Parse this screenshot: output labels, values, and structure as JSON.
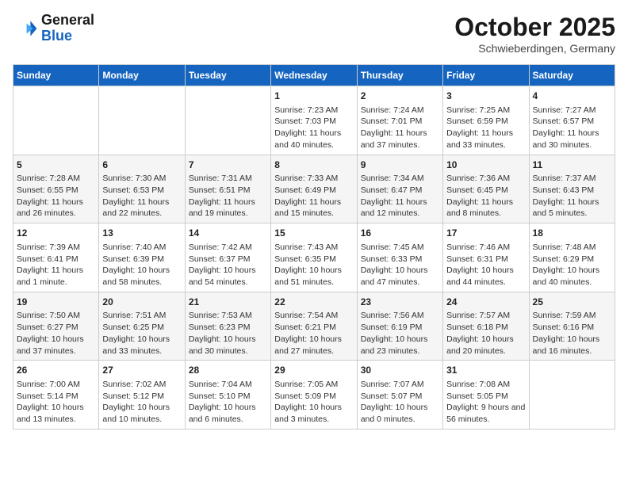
{
  "header": {
    "logo_line1": "General",
    "logo_line2": "Blue",
    "month": "October 2025",
    "location": "Schwieberdingen, Germany"
  },
  "weekdays": [
    "Sunday",
    "Monday",
    "Tuesday",
    "Wednesday",
    "Thursday",
    "Friday",
    "Saturday"
  ],
  "weeks": [
    [
      {
        "day": "",
        "info": ""
      },
      {
        "day": "",
        "info": ""
      },
      {
        "day": "",
        "info": ""
      },
      {
        "day": "1",
        "info": "Sunrise: 7:23 AM\nSunset: 7:03 PM\nDaylight: 11 hours and 40 minutes."
      },
      {
        "day": "2",
        "info": "Sunrise: 7:24 AM\nSunset: 7:01 PM\nDaylight: 11 hours and 37 minutes."
      },
      {
        "day": "3",
        "info": "Sunrise: 7:25 AM\nSunset: 6:59 PM\nDaylight: 11 hours and 33 minutes."
      },
      {
        "day": "4",
        "info": "Sunrise: 7:27 AM\nSunset: 6:57 PM\nDaylight: 11 hours and 30 minutes."
      }
    ],
    [
      {
        "day": "5",
        "info": "Sunrise: 7:28 AM\nSunset: 6:55 PM\nDaylight: 11 hours and 26 minutes."
      },
      {
        "day": "6",
        "info": "Sunrise: 7:30 AM\nSunset: 6:53 PM\nDaylight: 11 hours and 22 minutes."
      },
      {
        "day": "7",
        "info": "Sunrise: 7:31 AM\nSunset: 6:51 PM\nDaylight: 11 hours and 19 minutes."
      },
      {
        "day": "8",
        "info": "Sunrise: 7:33 AM\nSunset: 6:49 PM\nDaylight: 11 hours and 15 minutes."
      },
      {
        "day": "9",
        "info": "Sunrise: 7:34 AM\nSunset: 6:47 PM\nDaylight: 11 hours and 12 minutes."
      },
      {
        "day": "10",
        "info": "Sunrise: 7:36 AM\nSunset: 6:45 PM\nDaylight: 11 hours and 8 minutes."
      },
      {
        "day": "11",
        "info": "Sunrise: 7:37 AM\nSunset: 6:43 PM\nDaylight: 11 hours and 5 minutes."
      }
    ],
    [
      {
        "day": "12",
        "info": "Sunrise: 7:39 AM\nSunset: 6:41 PM\nDaylight: 11 hours and 1 minute."
      },
      {
        "day": "13",
        "info": "Sunrise: 7:40 AM\nSunset: 6:39 PM\nDaylight: 10 hours and 58 minutes."
      },
      {
        "day": "14",
        "info": "Sunrise: 7:42 AM\nSunset: 6:37 PM\nDaylight: 10 hours and 54 minutes."
      },
      {
        "day": "15",
        "info": "Sunrise: 7:43 AM\nSunset: 6:35 PM\nDaylight: 10 hours and 51 minutes."
      },
      {
        "day": "16",
        "info": "Sunrise: 7:45 AM\nSunset: 6:33 PM\nDaylight: 10 hours and 47 minutes."
      },
      {
        "day": "17",
        "info": "Sunrise: 7:46 AM\nSunset: 6:31 PM\nDaylight: 10 hours and 44 minutes."
      },
      {
        "day": "18",
        "info": "Sunrise: 7:48 AM\nSunset: 6:29 PM\nDaylight: 10 hours and 40 minutes."
      }
    ],
    [
      {
        "day": "19",
        "info": "Sunrise: 7:50 AM\nSunset: 6:27 PM\nDaylight: 10 hours and 37 minutes."
      },
      {
        "day": "20",
        "info": "Sunrise: 7:51 AM\nSunset: 6:25 PM\nDaylight: 10 hours and 33 minutes."
      },
      {
        "day": "21",
        "info": "Sunrise: 7:53 AM\nSunset: 6:23 PM\nDaylight: 10 hours and 30 minutes."
      },
      {
        "day": "22",
        "info": "Sunrise: 7:54 AM\nSunset: 6:21 PM\nDaylight: 10 hours and 27 minutes."
      },
      {
        "day": "23",
        "info": "Sunrise: 7:56 AM\nSunset: 6:19 PM\nDaylight: 10 hours and 23 minutes."
      },
      {
        "day": "24",
        "info": "Sunrise: 7:57 AM\nSunset: 6:18 PM\nDaylight: 10 hours and 20 minutes."
      },
      {
        "day": "25",
        "info": "Sunrise: 7:59 AM\nSunset: 6:16 PM\nDaylight: 10 hours and 16 minutes."
      }
    ],
    [
      {
        "day": "26",
        "info": "Sunrise: 7:00 AM\nSunset: 5:14 PM\nDaylight: 10 hours and 13 minutes."
      },
      {
        "day": "27",
        "info": "Sunrise: 7:02 AM\nSunset: 5:12 PM\nDaylight: 10 hours and 10 minutes."
      },
      {
        "day": "28",
        "info": "Sunrise: 7:04 AM\nSunset: 5:10 PM\nDaylight: 10 hours and 6 minutes."
      },
      {
        "day": "29",
        "info": "Sunrise: 7:05 AM\nSunset: 5:09 PM\nDaylight: 10 hours and 3 minutes."
      },
      {
        "day": "30",
        "info": "Sunrise: 7:07 AM\nSunset: 5:07 PM\nDaylight: 10 hours and 0 minutes."
      },
      {
        "day": "31",
        "info": "Sunrise: 7:08 AM\nSunset: 5:05 PM\nDaylight: 9 hours and 56 minutes."
      },
      {
        "day": "",
        "info": ""
      }
    ]
  ]
}
